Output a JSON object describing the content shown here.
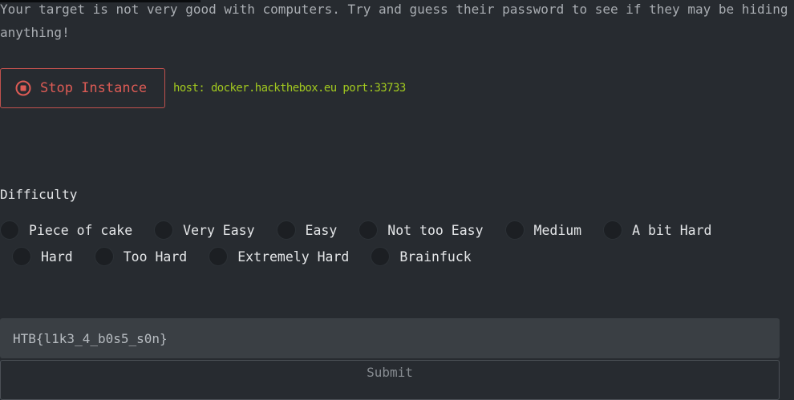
{
  "challenge": {
    "description": "Your target is not very good with computers. Try and guess their password to see if they may be hiding anything!"
  },
  "instance": {
    "stop_label": "Stop Instance",
    "host_info": "host: docker.hackthebox.eu port:33733"
  },
  "difficulty": {
    "label": "Difficulty",
    "options": [
      "Piece of cake",
      "Very Easy",
      "Easy",
      "Not too Easy",
      "Medium",
      "A bit Hard",
      "Hard",
      "Too Hard",
      "Extremely Hard",
      "Brainfuck"
    ]
  },
  "flag": {
    "value": "HTB{l1k3_4_b0s5_s0n}"
  },
  "submit": {
    "label": "Submit"
  },
  "colors": {
    "background": "#272b30",
    "danger": "#dd5b55",
    "host_green": "#a1c81f",
    "input_bg": "#3a3f44"
  }
}
